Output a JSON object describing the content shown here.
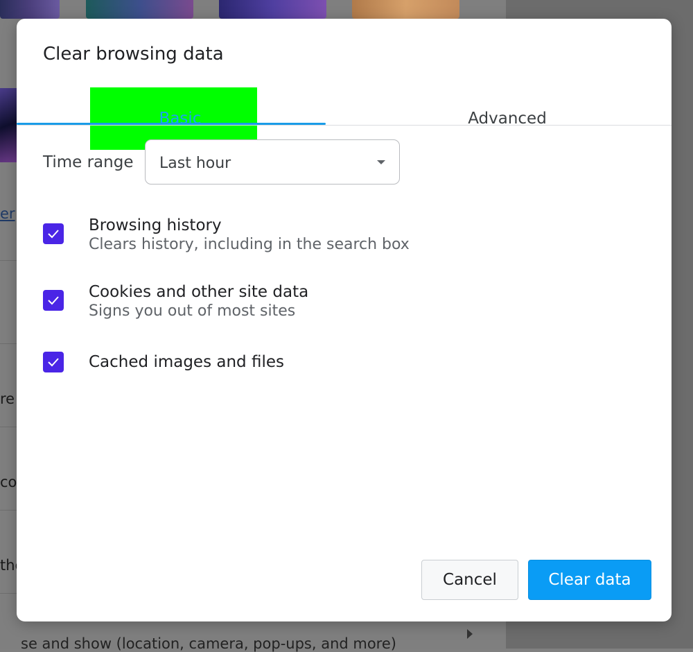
{
  "background": {
    "link_fragment": "er",
    "row_fragments": [
      "re",
      "co",
      "the"
    ],
    "bottom_text": "se and show (location, camera, pop-ups, and more)"
  },
  "dialog": {
    "title": "Clear browsing data",
    "tabs": [
      {
        "label": "Basic",
        "selected": true
      },
      {
        "label": "Advanced",
        "selected": false
      }
    ],
    "time_range": {
      "label": "Time range",
      "value": "Last hour"
    },
    "options": [
      {
        "title": "Browsing history",
        "subtitle": "Clears history, including in the search box",
        "checked": true
      },
      {
        "title": "Cookies and other site data",
        "subtitle": "Signs you out of most sites",
        "checked": true
      },
      {
        "title": "Cached images and files",
        "subtitle": "",
        "checked": true
      }
    ],
    "buttons": {
      "cancel": "Cancel",
      "clear": "Clear data"
    }
  },
  "colors": {
    "accent": "#1a9ce8",
    "checkbox": "#4a25e6",
    "primary_button": "#0a9cf5",
    "tab_highlight": "#00ff00"
  }
}
